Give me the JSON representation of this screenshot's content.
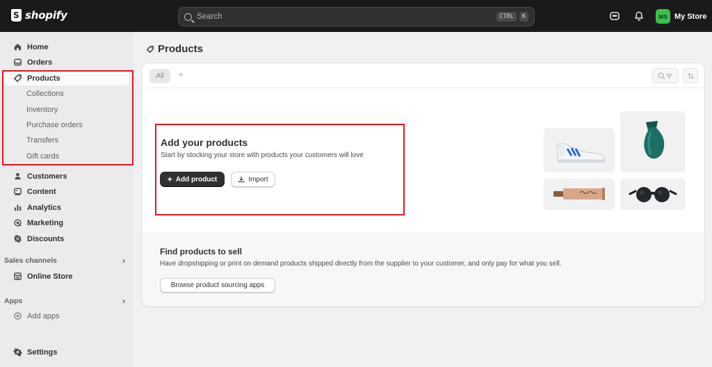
{
  "topbar": {
    "logo_text": "shopify",
    "search_placeholder": "Search",
    "shortcut_ctrl": "CTRL",
    "shortcut_k": "K",
    "store_initials": "MS",
    "store_name": "My Store"
  },
  "sidebar": {
    "items": [
      {
        "label": "Home",
        "icon": "home-icon"
      },
      {
        "label": "Orders",
        "icon": "inbox-icon"
      },
      {
        "label": "Products",
        "icon": "tag-icon"
      },
      {
        "label": "Customers",
        "icon": "person-icon"
      },
      {
        "label": "Content",
        "icon": "content-icon"
      },
      {
        "label": "Analytics",
        "icon": "bar-chart-icon"
      },
      {
        "label": "Marketing",
        "icon": "target-icon"
      },
      {
        "label": "Discounts",
        "icon": "discount-icon"
      }
    ],
    "product_subitems": [
      "Collections",
      "Inventory",
      "Purchase orders",
      "Transfers",
      "Gift cards"
    ],
    "sales_channels_label": "Sales channels",
    "online_store": "Online Store",
    "apps_label": "Apps",
    "add_apps": "Add apps",
    "settings": "Settings"
  },
  "main": {
    "page_title": "Products",
    "tab_all": "All",
    "tab_add": "+",
    "empty_title": "Add your products",
    "empty_desc": "Start by stocking your store with products your customers will love",
    "add_product_label": "Add product",
    "import_label": "Import",
    "find_title": "Find products to sell",
    "find_desc": "Have dropshipping or print on demand products shipped directly from the supplier to your customer, and only pay for what you sell.",
    "browse_label": "Browse product sourcing apps"
  },
  "colors": {
    "highlight": "#e0161e",
    "avatar": "#36c24a",
    "topbar": "#1a1a1a"
  }
}
